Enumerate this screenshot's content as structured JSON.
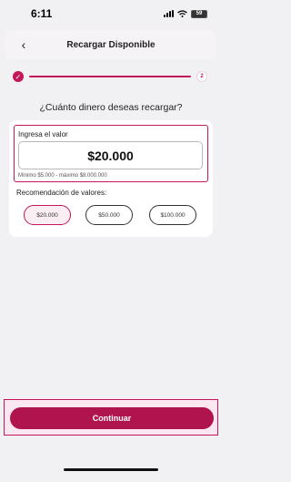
{
  "status_bar": {
    "time": "6:11",
    "battery": "59"
  },
  "header": {
    "back_icon": "‹",
    "title": "Recargar Disponible"
  },
  "stepper": {
    "done_icon": "✓",
    "current_step": "2",
    "accent": "#c2185b"
  },
  "question": "¿Cuánto dinero deseas recargar?",
  "amount": {
    "label": "Ingresa el valor",
    "value": "$20.000",
    "hint": "Mínimo $5.000 - máximo $8.000.000"
  },
  "recommendations": {
    "label": "Recomendación de valores:",
    "options": [
      {
        "label": "$20.000",
        "selected": true
      },
      {
        "label": "$50.000",
        "selected": false
      },
      {
        "label": "$100.000",
        "selected": false
      }
    ]
  },
  "continue_label": "Continuar",
  "colors": {
    "brand": "#b0144f",
    "background": "#f1f0f3"
  }
}
